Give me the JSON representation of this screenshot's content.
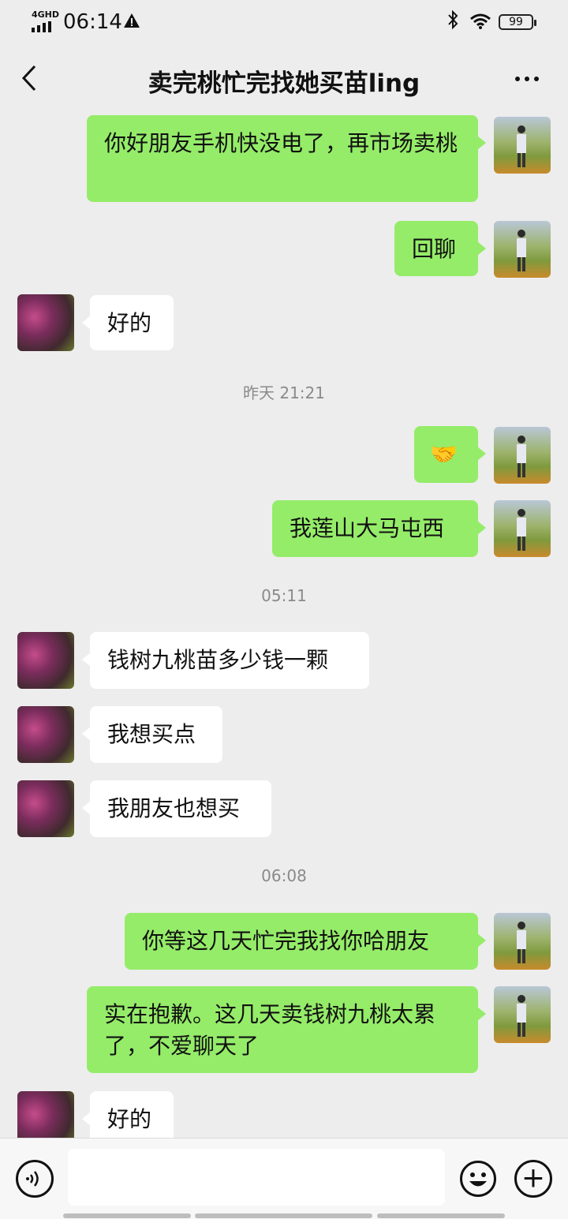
{
  "status_bar": {
    "network": "4GHD",
    "time": "06:14",
    "battery": "99"
  },
  "header": {
    "title": "卖完桃忙完找她买苗ling"
  },
  "messages": [
    {
      "from": "me",
      "text": "你好朋友手机快没电了，再市场卖桃"
    },
    {
      "from": "me",
      "text": "回聊"
    },
    {
      "from": "other",
      "text": "好的"
    },
    {
      "type": "time",
      "text": "昨天 21:21"
    },
    {
      "from": "me",
      "emoji": "🤝"
    },
    {
      "from": "me",
      "text": "我莲山大马屯西"
    },
    {
      "type": "time",
      "text": "05:11"
    },
    {
      "from": "other",
      "text": "钱树九桃苗多少钱一颗"
    },
    {
      "from": "other",
      "text": "我想买点"
    },
    {
      "from": "other",
      "text": "我朋友也想买"
    },
    {
      "type": "time",
      "text": "06:08"
    },
    {
      "from": "me",
      "text": "你等这几天忙完我找你哈朋友"
    },
    {
      "from": "me",
      "text": "实在抱歉。这几天卖钱树九桃太累了，不爱聊天了"
    },
    {
      "from": "other",
      "text": "好的"
    }
  ],
  "icons": {
    "back": "chevron-left-icon",
    "more": "more-dots-icon",
    "voice": "voice-icon",
    "emoji": "emoji-icon",
    "plus": "plus-icon"
  },
  "colors": {
    "my_bubble": "#95ec69",
    "their_bubble": "#ffffff",
    "background": "#ededed"
  }
}
